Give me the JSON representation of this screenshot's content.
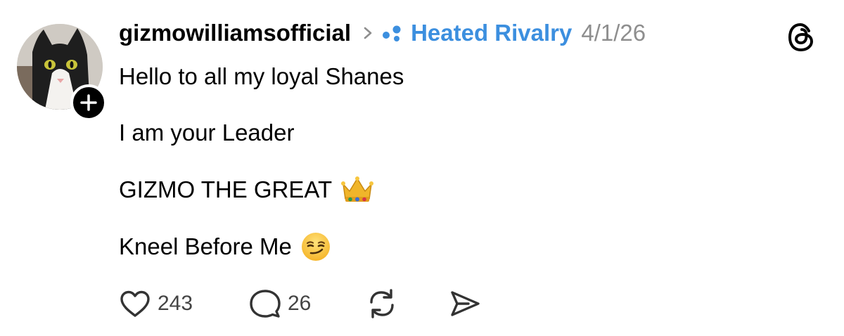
{
  "post": {
    "author": "gizmowilliamsofficial",
    "community": "Heated Rivalry",
    "timestamp": "4/1/26",
    "lines": [
      "Hello to all my loyal Shanes",
      "I am your Leader",
      "GIZMO THE GREAT",
      "Kneel Before Me"
    ],
    "emojis": [
      "crown-emoji",
      "smirking-face-emoji"
    ]
  },
  "actions": {
    "likes": "243",
    "replies": "26"
  },
  "icons": [
    "avatar",
    "plus-icon",
    "chevron-right-icon",
    "community-icon",
    "threads-logo-icon",
    "heart-icon",
    "comment-icon",
    "repost-icon",
    "share-icon"
  ],
  "colors": {
    "community_link": "#3c8fdf",
    "timestamp": "#8e8e8e",
    "count": "#444444"
  }
}
